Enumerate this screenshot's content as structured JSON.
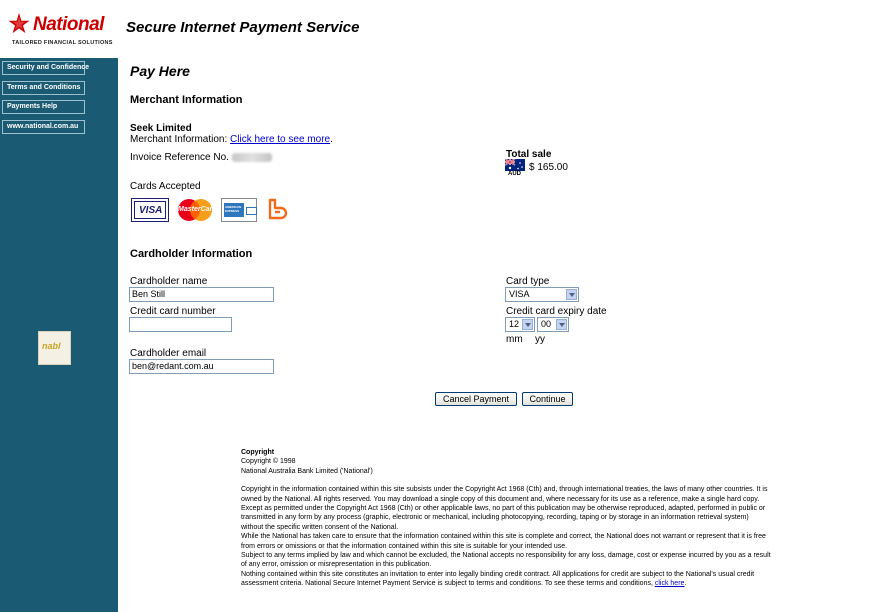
{
  "brand": {
    "logo_text": "National",
    "tagline": "TAILORED FINANCIAL SOLUTIONS",
    "service_title": "Secure Internet Payment Service",
    "red": "#cc0000",
    "sidebar_color": "#1a5b73"
  },
  "sidebar": {
    "items": [
      {
        "label": "Security and Confidence"
      },
      {
        "label": "Terms and Conditions"
      },
      {
        "label": "Payments Help"
      },
      {
        "label": "www.national.com.au"
      }
    ],
    "badge_text": "nabl"
  },
  "page": {
    "title": "Pay Here",
    "merchant_heading": "Merchant Information",
    "merchant_name": "Seek Limited",
    "merchant_info_label": "Merchant Information:",
    "merchant_info_link": "Click here to see more",
    "merchant_info_period": ".",
    "invoice_label": "Invoice Reference No.",
    "total_label": "Total sale",
    "currency_code": "AUD",
    "total_amount": "$ 165.00",
    "cards_accepted_label": "Cards Accepted",
    "cards": [
      "VISA",
      "MasterCard",
      "AMERICAN EXPRESS",
      "bankcard"
    ]
  },
  "cardholder": {
    "heading": "Cardholder Information",
    "name_label": "Cardholder name",
    "name_value": "Ben Still",
    "number_label": "Credit card number",
    "number_value": "",
    "email_label": "Cardholder email",
    "email_value": "ben@redant.com.au",
    "card_type_label": "Card type",
    "card_type_value": "VISA",
    "expiry_label": "Credit card expiry date",
    "expiry_month": "12",
    "expiry_year": "00",
    "mm_label": "mm",
    "yy_label": "yy"
  },
  "actions": {
    "cancel_label": "Cancel Payment",
    "continue_label": "Continue"
  },
  "copyright": {
    "heading": "Copyright",
    "line1": "Copyright © 1998",
    "line2": "National Australia Bank Limited ('National')",
    "para1": "Copyright in the information contained within this site subsists under the Copyright Act 1968 (Cth) and, through international treaties, the laws of many other countries. It is owned by the National. All rights reserved. You may download a single copy of this document and, where necessary for its use as a reference, make a single hard copy. Except as permitted under the Copyright Act 1968 (Cth) or other applicable laws, no part of this publication may be otherwise reproduced, adapted, performed in public or transmitted in any form by any process (graphic, electronic or mechanical, including photocopying, recording, taping or by storage in an information retrieval system) without the specific written consent of the National.",
    "para2": "While the National has taken care to ensure that the information contained within this site is complete and correct, the National does not warrant or represent that it is free from errors or omissions or that the information contained within this site is suitable for your intended use.",
    "para3": "Subject to any terms implied by law and which cannot be excluded, the National accepts no responsibility for any loss, damage, cost or expense incurred by you as a result of any error, omission or misrepresentation in this publication.",
    "para4": "Nothing contained within this site constitutes an invitation to enter into legally binding credit contract. All applications for credit are subject to the National's usual credit assessment criteria. National Secure Internet Payment Service is subject to terms and conditions. To see these terms and conditions,",
    "para4_link": "click here",
    "para4_end": "."
  }
}
